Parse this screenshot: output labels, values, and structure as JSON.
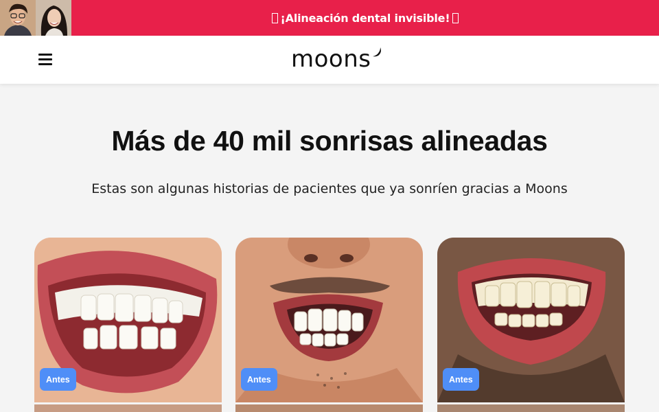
{
  "promo": {
    "text": "¡Alineación dental invisible!",
    "avatars": [
      "avatar-man",
      "avatar-woman"
    ],
    "background": "#e8204a"
  },
  "header": {
    "menu_icon": "hamburger-menu-icon",
    "logo_text": "moons",
    "logo_icon": "crescent-moon-icon"
  },
  "hero": {
    "title": "Más de 40 mil sonrisas alineadas",
    "subtitle": "Estas son algunas historias de pacientes que ya sonríen gracias a Moons"
  },
  "cards": [
    {
      "badge": "Antes",
      "image": "smile-before-photo-1"
    },
    {
      "badge": "Antes",
      "image": "smile-before-photo-2"
    },
    {
      "badge": "Antes",
      "image": "smile-before-photo-3"
    }
  ],
  "colors": {
    "badge": "#4f8ef7",
    "page_bg": "#f4f4f4"
  }
}
